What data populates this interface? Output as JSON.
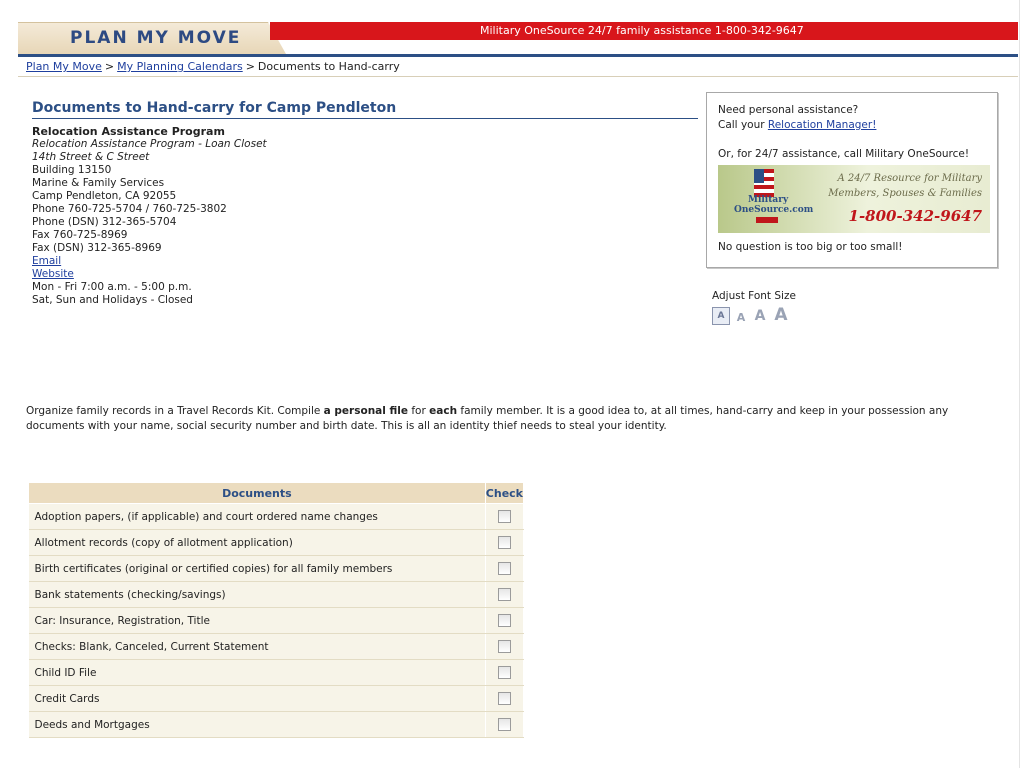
{
  "header": {
    "logo": "PLAN MY MOVE",
    "banner": "Military OneSource 24/7 family assistance 1-800-342-9647"
  },
  "breadcrumb": {
    "items": [
      "Plan My Move",
      "My Planning Calendars"
    ],
    "current": "Documents to Hand-carry",
    "sep": ">"
  },
  "main": {
    "title": "Documents to Hand-carry for Camp Pendleton",
    "org": "Relocation Assistance Program",
    "lines_italic": [
      "Relocation Assistance Program - Loan Closet",
      "14th Street & C Street"
    ],
    "lines": [
      "Building 13150",
      "Marine & Family Services",
      "Camp Pendleton, CA 92055",
      "Phone 760-725-5704 / 760-725-3802",
      "Phone (DSN) 312-365-5704",
      "Fax 760-725-8969",
      "Fax (DSN) 312-365-8969"
    ],
    "email_link": "Email",
    "website_link": "Website",
    "hours": [
      "Mon - Fri 7:00 a.m. - 5:00 p.m.",
      "Sat, Sun and Holidays - Closed"
    ]
  },
  "assist": {
    "line1": "Need personal assistance?",
    "line2_prefix": "Call your ",
    "line2_link": "Relocation Manager!",
    "line3": "Or, for 24/7 assistance, call Military OneSource!",
    "banner_tag1": "A 24/7 Resource for Military",
    "banner_tag2": "Members, Spouses & Families",
    "banner_phone": "1-800-342-9647",
    "banner_logo1": "Military",
    "banner_logo2": "OneSource.com",
    "line4": "No question is too big or too small!"
  },
  "font_size": {
    "label": "Adjust Font Size",
    "options": [
      "A",
      "A",
      "A",
      "A"
    ]
  },
  "intro": {
    "p1": "Organize family records in a Travel Records Kit. Compile ",
    "b1": "a personal file",
    "p2": " for ",
    "b2": "each",
    "p3": " family member. It is a good idea to, at all times, hand-carry and keep in your possession any documents with your name, social security number and birth date.  This is all an identity thief needs to steal your identity."
  },
  "table": {
    "headers": [
      "Documents",
      "Check"
    ],
    "rows": [
      "Adoption papers, (if applicable) and court ordered name changes",
      "Allotment records (copy of allotment application)",
      "Birth certificates (original or certified copies) for all family members",
      "Bank statements (checking/savings)",
      "Car: Insurance, Registration, Title",
      "Checks: Blank, Canceled, Current Statement",
      "Child ID File",
      "Credit Cards",
      "Deeds and Mortgages"
    ]
  }
}
